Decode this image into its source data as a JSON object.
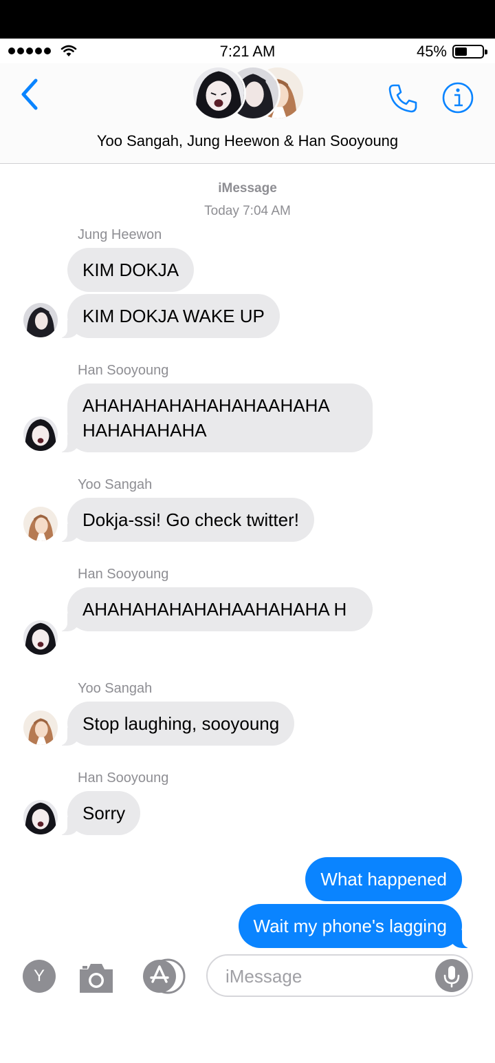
{
  "status_bar": {
    "time": "7:21 AM",
    "battery_percent": "45%",
    "battery_level": 0.45
  },
  "header": {
    "title": "Yoo Sangah, Jung Heewon & Han Sooyoung"
  },
  "thread_meta": {
    "service": "iMessage",
    "timestamp": "Today 7:04 AM"
  },
  "messages": [
    {
      "sender": "Jung Heewon",
      "text": "KIM DOKJA",
      "direction": "incoming"
    },
    {
      "text": "KIM DOKJA WAKE UP",
      "direction": "incoming"
    },
    {
      "sender": "Han Sooyoung",
      "text": "AHAHAHAHAHAHAHAAHAHA HAHAHAHAHA",
      "direction": "incoming"
    },
    {
      "sender": "Yoo Sangah",
      "text": "Dokja-ssi! Go check twitter!",
      "direction": "incoming"
    },
    {
      "sender": "Han Sooyoung",
      "text": "AHAHAHAHAHAHAAHAHAHA H",
      "direction": "incoming"
    },
    {
      "sender": "Yoo Sangah",
      "text": "Stop laughing, sooyoung",
      "direction": "incoming"
    },
    {
      "sender": "Han Sooyoung",
      "text": "Sorry",
      "direction": "incoming"
    },
    {
      "text": "What happened",
      "direction": "outgoing"
    },
    {
      "text": "Wait my phone's lagging",
      "direction": "outgoing"
    }
  ],
  "composer": {
    "apps_label": "Y",
    "placeholder": "iMessage"
  },
  "colors": {
    "accent": "#0a84ff",
    "incoming_bubble": "#e9e9eb",
    "meta_text": "#8e8e93"
  },
  "icons": [
    "signal-icon",
    "wifi-icon",
    "battery-icon",
    "back-chevron-icon",
    "phone-icon",
    "info-icon",
    "camera-icon",
    "app-store-icon",
    "microphone-icon"
  ]
}
